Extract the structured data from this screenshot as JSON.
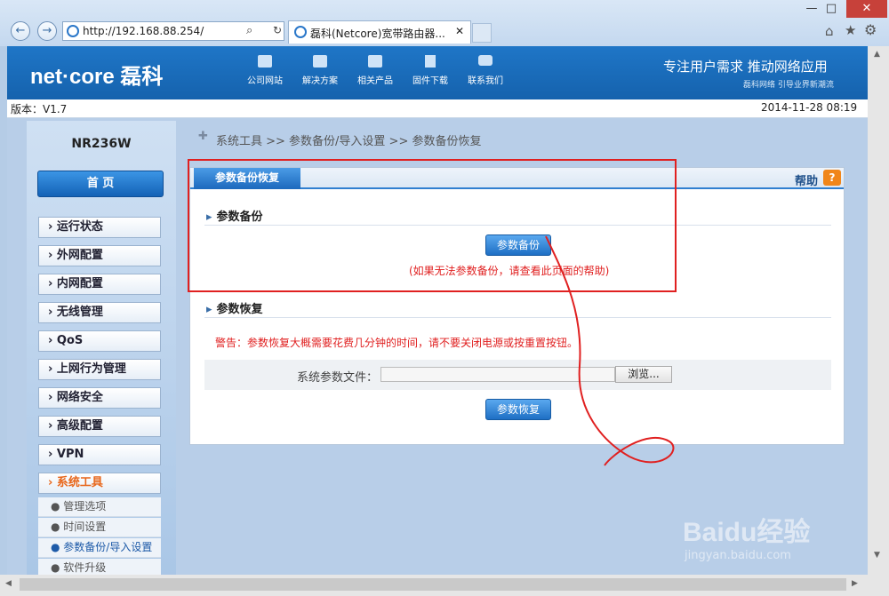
{
  "browser": {
    "address": "http://192.168.88.254/",
    "tab_title": "磊科(Netcore)宽带路由器...",
    "back_label": "←",
    "forward_label": "→",
    "minimize": "—",
    "maximize": "□",
    "close": "✕"
  },
  "header": {
    "logo": "net·core 磊科",
    "slogan": "专注用户需求  推动网络应用",
    "slogan_sub": "磊科网络 引导业界新潮流",
    "nav": [
      "公司网站",
      "解决方案",
      "相关产品",
      "固件下载",
      "联系我们"
    ]
  },
  "version_bar": {
    "version": "版本：V1.7",
    "datetime": "2014-11-28 08:19"
  },
  "sidebar": {
    "model": "NR236W",
    "home": "首 页",
    "items": [
      {
        "label": "运行状态"
      },
      {
        "label": "外网配置"
      },
      {
        "label": "内网配置"
      },
      {
        "label": "无线管理"
      },
      {
        "label": "QoS"
      },
      {
        "label": "上网行为管理"
      },
      {
        "label": "网络安全"
      },
      {
        "label": "高级配置"
      },
      {
        "label": "VPN"
      },
      {
        "label": "系统工具"
      }
    ],
    "subitems": [
      "管理选项",
      "时间设置",
      "参数备份/导入设置",
      "软件升级"
    ]
  },
  "breadcrumb": "系统工具  >>  参数备份/导入设置  >>  参数备份恢复",
  "panel": {
    "tab": "参数备份恢复",
    "help": "帮助",
    "backup_title": "参数备份",
    "backup_button": "参数备份",
    "backup_note": "(如果无法参数备份，请查看此页面的帮助)",
    "restore_title": "参数恢复",
    "warning": "警告：参数恢复大概需要花费几分钟的时间，请不要关闭电源或按重置按钮。",
    "file_label": "系统参数文件：",
    "browse": "浏览...",
    "restore_button": "参数恢复"
  },
  "watermark": {
    "brand": "Baidu经验",
    "url": "jingyan.baidu.com"
  },
  "colors": {
    "header_blue": "#1a6cbd",
    "annotation_red": "#e02020",
    "button_blue": "#2a7fd4"
  }
}
